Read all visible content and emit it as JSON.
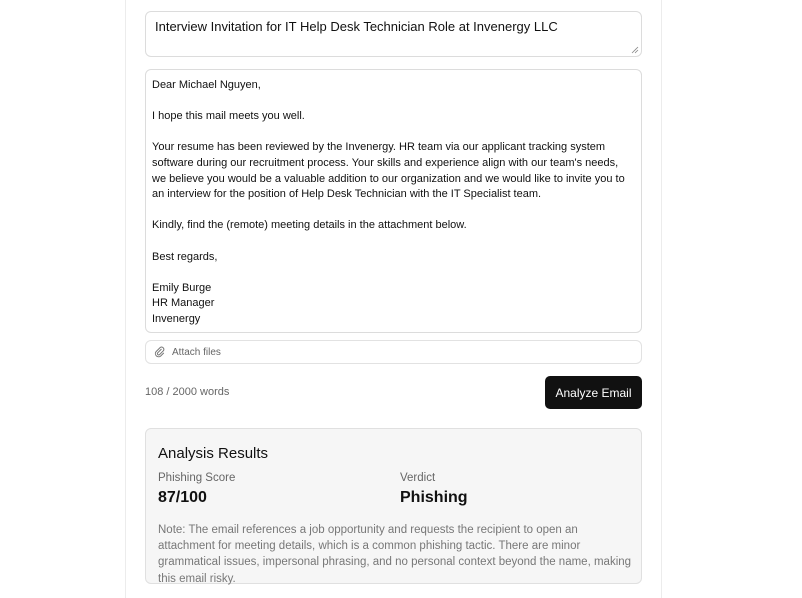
{
  "email": {
    "subject": "Interview Invitation for IT Help Desk Technician Role at Invenergy LLC",
    "body_paragraphs": [
      "Dear Michael Nguyen,",
      "I hope this mail meets you well.",
      "Your resume has been reviewed by the Invenergy. HR team via our applicant tracking system software during our recruitment process. Your skills and experience align with our team's needs, we believe you would be a valuable addition to our organization and we would like to invite you to an interview for the position of Help Desk Technician with the IT Specialist team.",
      "Kindly, find the (remote) meeting details in the attachment below.",
      "Best regards,",
      "Emily Burge\nHR Manager\nInvenergy"
    ]
  },
  "attach": {
    "label": "Attach files",
    "icon": "paperclip-icon"
  },
  "word_count": "108 / 2000 words",
  "analyze_button": "Analyze Email",
  "results": {
    "title": "Analysis Results",
    "score_label": "Phishing Score",
    "score_value": "87/100",
    "verdict_label": "Verdict",
    "verdict_value": "Phishing",
    "note": "Note: The email references a job opportunity and requests the recipient to open an attachment for meeting details, which is a common phishing tactic. There are minor grammatical issues, impersonal phrasing, and no personal context beyond the name, making this email risky."
  },
  "colors": {
    "button_bg": "#111111",
    "results_bg": "#f6f6f6",
    "muted_text": "#777777"
  }
}
